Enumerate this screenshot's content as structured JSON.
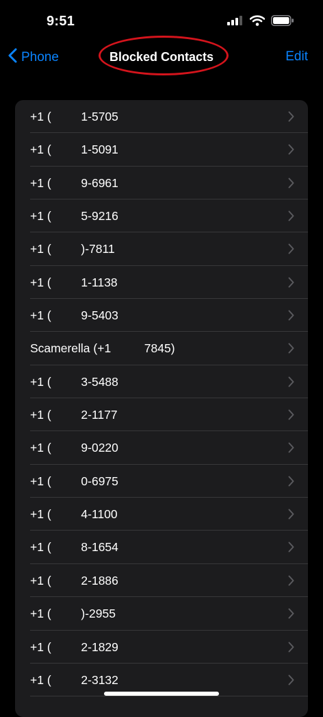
{
  "status_bar": {
    "time": "9:51"
  },
  "nav": {
    "back_label": "Phone",
    "title": "Blocked Contacts",
    "edit_label": "Edit"
  },
  "contacts": [
    "+1 (         1-5705",
    "+1 (         1-5091",
    "+1 (         9-6961",
    "+1 (         5-9216",
    "+1 (         )-7811",
    "+1 (         1-1138",
    "+1 (         9-5403",
    "Scamerella (+1          7845)",
    "+1 (         3-5488",
    "+1 (         2-1177",
    "+1 (         9-0220",
    "+1 (         0-6975",
    "+1 (         4-1100",
    "+1 (         8-1654",
    "+1 (         2-1886",
    "+1 (         )-2955",
    "+1 (         2-1829",
    "+1 (         2-3132"
  ],
  "colors": {
    "accent": "#0a84ff",
    "highlight": "#d4141c",
    "card": "#1c1c1e"
  }
}
